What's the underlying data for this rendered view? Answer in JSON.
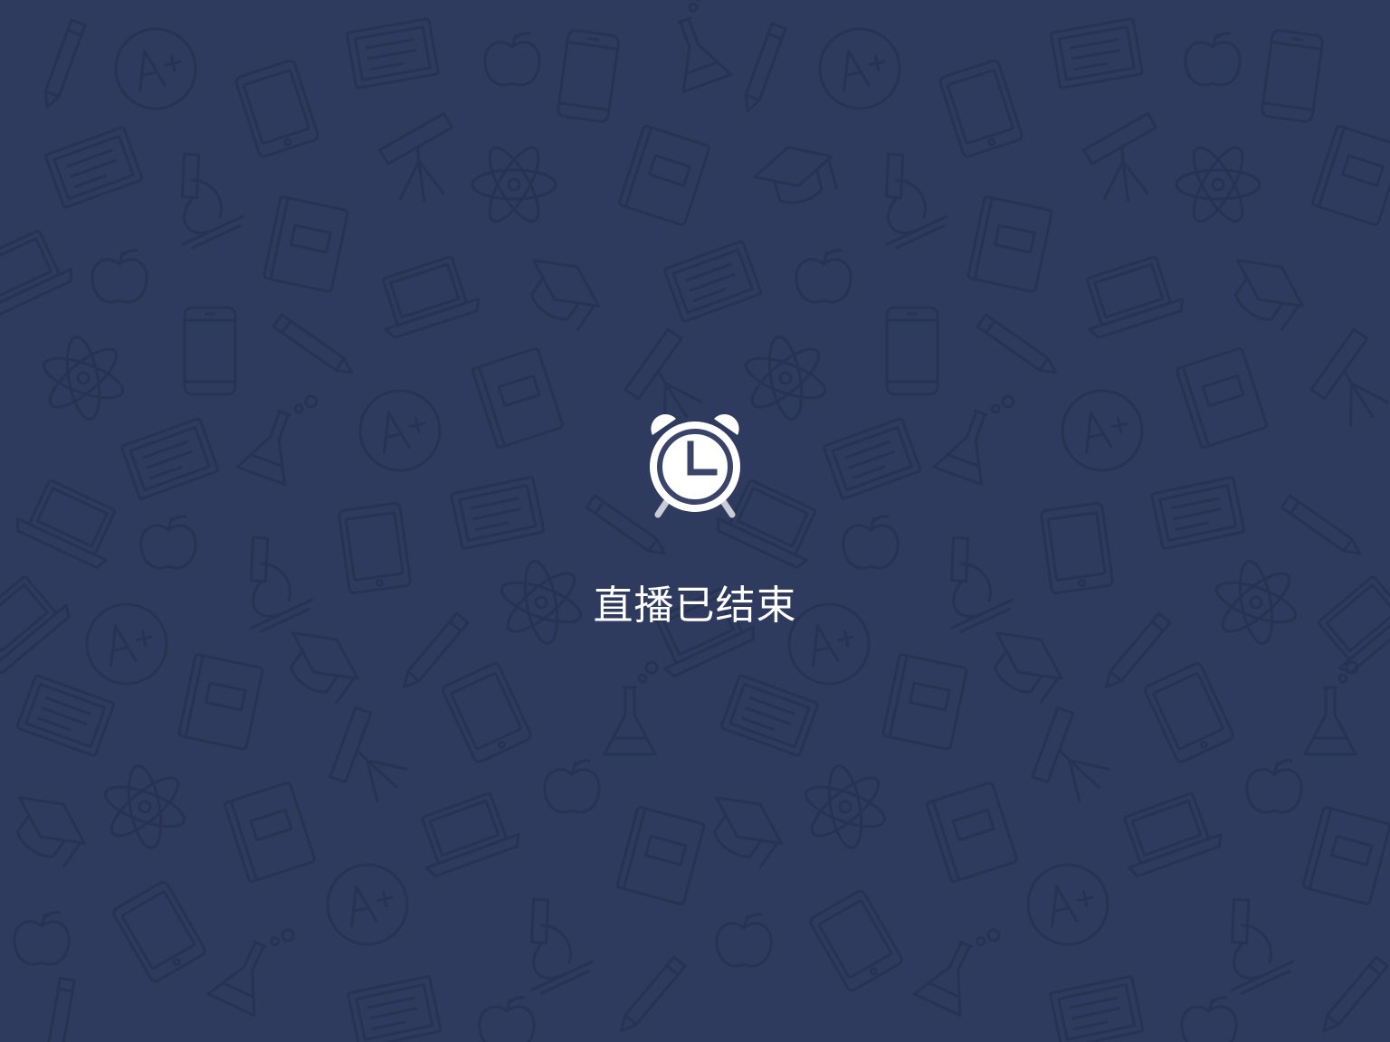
{
  "colors": {
    "background": "#2f3a5f",
    "doodle_stroke": "#283252",
    "icon_fill": "#ffffff",
    "icon_accent": "#3a4468",
    "icon_legs": "#c9ccd6",
    "text": "#ffffff"
  },
  "background_pattern": {
    "icons": [
      "grade-a-plus-icon",
      "tablet-icon",
      "phone-icon",
      "apple-icon",
      "pencil-icon",
      "atom-icon",
      "microscope-icon",
      "flask-icon",
      "telescope-icon",
      "book-icon",
      "laptop-icon",
      "blackboard-icon",
      "graduation-cap-icon"
    ]
  },
  "status": {
    "icon": "alarm-clock-icon",
    "message": "直播已结束"
  }
}
